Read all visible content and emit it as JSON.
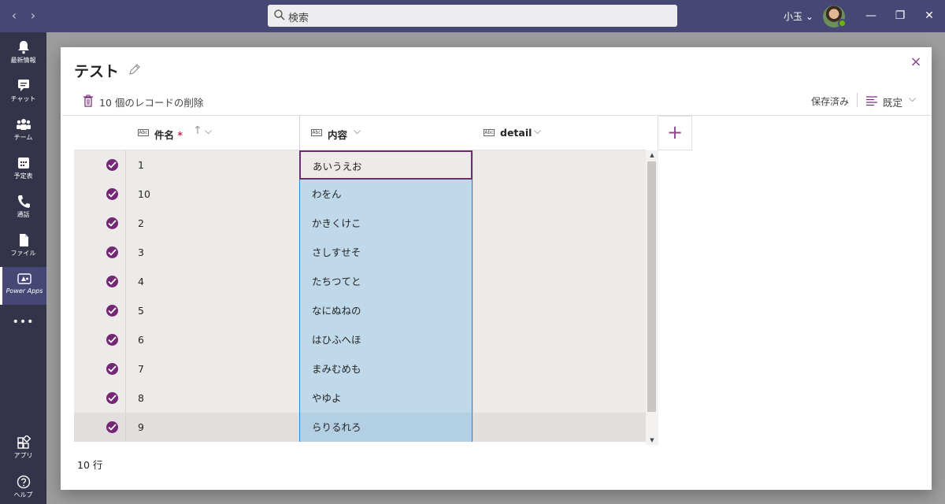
{
  "titlebar": {
    "search_placeholder": "検索",
    "user_name": "小玉 ⌄",
    "back": "‹",
    "forward": "›",
    "minimize": "—",
    "restore": "❐",
    "close": "✕"
  },
  "rail": {
    "items": [
      {
        "label": "最新情報",
        "icon": "bell-icon"
      },
      {
        "label": "チャット",
        "icon": "chat-icon"
      },
      {
        "label": "チーム",
        "icon": "teams-icon"
      },
      {
        "label": "予定表",
        "icon": "calendar-icon"
      },
      {
        "label": "通話",
        "icon": "phone-icon"
      },
      {
        "label": "ファイル",
        "icon": "file-icon"
      },
      {
        "label": "Power Apps",
        "icon": "powerapps-icon"
      },
      {
        "label": "•••",
        "icon": "more-icon"
      },
      {
        "label": "アプリ",
        "icon": "apps-icon"
      },
      {
        "label": "ヘルプ",
        "icon": "help-icon"
      }
    ]
  },
  "dialog": {
    "title": "テスト",
    "delete_label": "10 個のレコードの削除",
    "saved_label": "保存済み",
    "view_label": "既定",
    "close_symbol": "×",
    "row_count": "10 行"
  },
  "grid": {
    "columns": [
      {
        "name": "件名",
        "required_mark": "*",
        "abc": "Abc"
      },
      {
        "name": "内容",
        "abc": "Abc"
      },
      {
        "name": "detail",
        "abc": "Abc"
      }
    ],
    "add_column_symbol": "+",
    "rows": [
      {
        "name": "1",
        "content": "あいうえお",
        "detail": ""
      },
      {
        "name": "10",
        "content": "わをん",
        "detail": ""
      },
      {
        "name": "2",
        "content": "かきくけこ",
        "detail": ""
      },
      {
        "name": "3",
        "content": "さしすせそ",
        "detail": ""
      },
      {
        "name": "4",
        "content": "たちつてと",
        "detail": ""
      },
      {
        "name": "5",
        "content": "なにぬねの",
        "detail": ""
      },
      {
        "name": "6",
        "content": "はひふへほ",
        "detail": ""
      },
      {
        "name": "7",
        "content": "まみむめも",
        "detail": ""
      },
      {
        "name": "8",
        "content": "やゆよ",
        "detail": ""
      },
      {
        "name": "9",
        "content": "らりるれろ",
        "detail": ""
      }
    ]
  },
  "colors": {
    "teams_purple": "#464775",
    "rail_bg": "#33344a",
    "accent_purple": "#742774",
    "column_highlight": "#bfd9ea"
  }
}
